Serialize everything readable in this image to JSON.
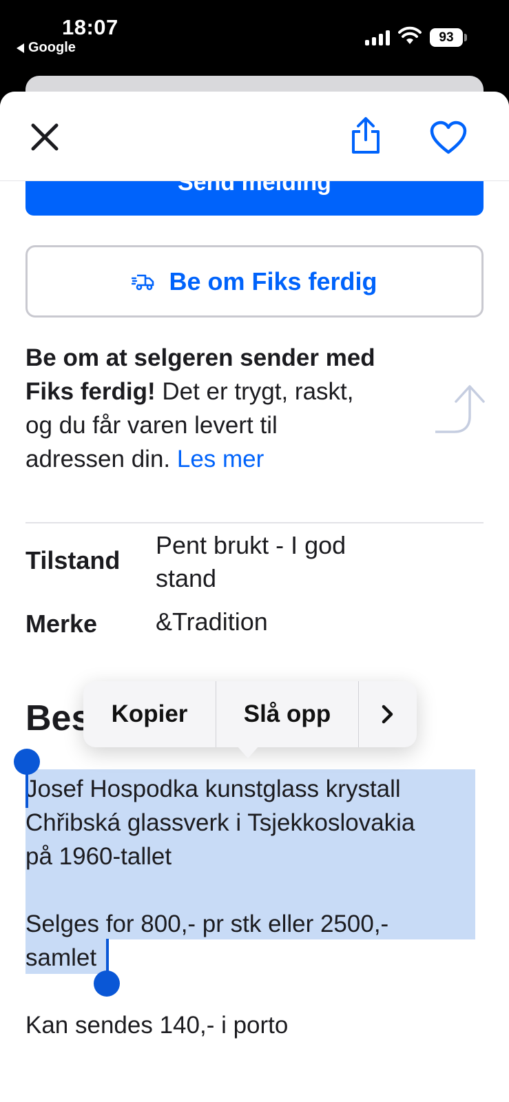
{
  "status_bar": {
    "time": "18:07",
    "back_app": "Google",
    "battery": "93"
  },
  "toolbar": {
    "close_icon": "close-icon",
    "share_icon": "share-icon",
    "favorite_icon": "heart-icon"
  },
  "actions": {
    "send_message": "Send melding",
    "fiks_button": "Be om Fiks ferdig"
  },
  "fiks_info": {
    "bold_line1": "Be om at selgeren sender med",
    "bold_line2": "Fiks ferdig!",
    "text_line2": " Det er trygt, raskt,",
    "text_line3": "og du får varen levert til",
    "text_line4": "adressen din. ",
    "link": "Les mer"
  },
  "specs": [
    {
      "label": "Tilstand",
      "value": "Pent brukt - I god stand"
    },
    {
      "label": "Merke",
      "value": "&Tradition"
    }
  ],
  "description": {
    "heading": "Beskrivelse",
    "lines": [
      "Josef Hospodka kunstglass krystall",
      "Chřibská glassverk i Tsjekkoslovakia",
      "på 1960-tallet",
      "",
      "Selges for 800,- pr stk eller 2500,-",
      "samlet",
      "",
      "Kan sendes 140,- i porto"
    ]
  },
  "context_menu": {
    "copy": "Kopier",
    "look_up": "Slå opp",
    "more": "›"
  },
  "colors": {
    "accent": "#0063fb",
    "selection": "#c8dbf6",
    "handle": "#0a57d6"
  }
}
